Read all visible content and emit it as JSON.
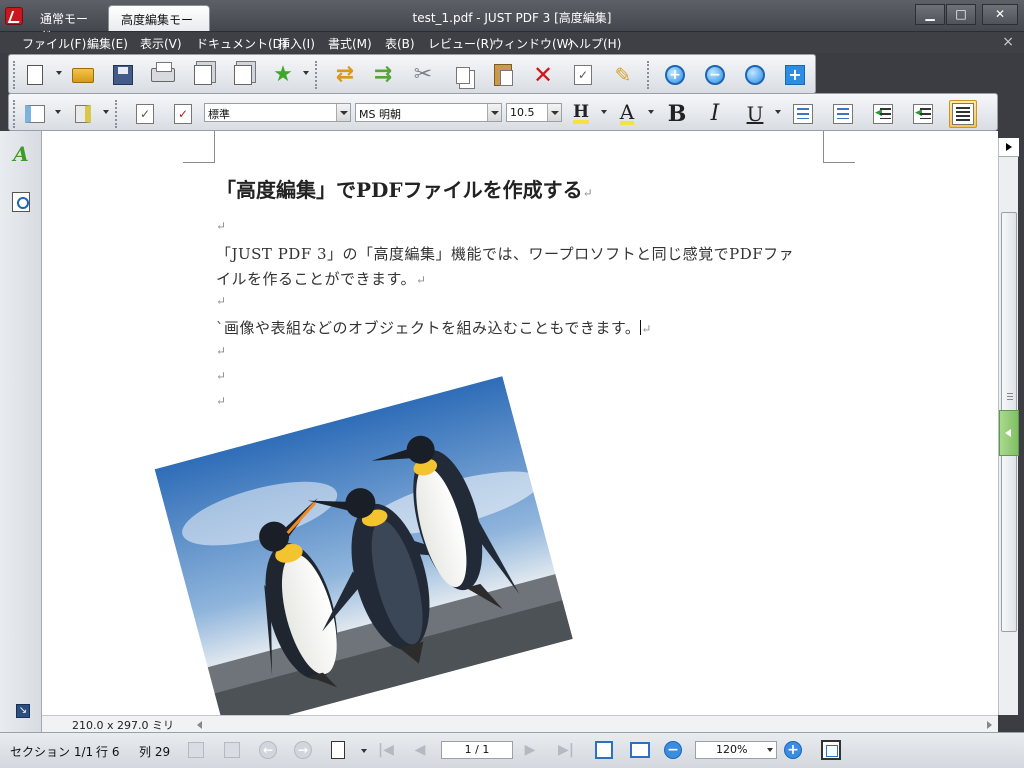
{
  "window": {
    "title": "test_1.pdf - JUST PDF 3 [高度編集]",
    "tabs": [
      {
        "label": "通常モード",
        "active": false
      },
      {
        "label": "高度編集モード",
        "active": true
      }
    ],
    "controls": {
      "minimize": "▁",
      "maximize": "□",
      "close": "✕"
    }
  },
  "menu": {
    "items": [
      "ファイル(F)",
      "編集(E)",
      "表示(V)",
      "ドキュメント(D)",
      "挿入(I)",
      "書式(M)",
      "表(B)",
      "レビュー(R)",
      "ウィンドウ(W)",
      "ヘルプ(H)"
    ],
    "close_label": "×"
  },
  "toolbar1": {
    "icons": [
      "new-document-icon",
      "open-folder-icon",
      "save-icon",
      "print-icon",
      "export-icon",
      "page-settings-icon",
      "favorite-star-icon",
      "undo-arrow-icon",
      "redo-arrow-icon",
      "cut-scissors-icon",
      "copy-icon",
      "paste-icon",
      "delete-x-icon",
      "text-select-icon",
      "format-brush-icon",
      "zoom-in-icon",
      "zoom-out-icon",
      "zoom-icon",
      "add-icon"
    ],
    "glyphs": {
      "star": "★",
      "arrow_left": "⇄",
      "arrow_right": "⇉",
      "scissors": "✂",
      "x": "✕",
      "brush": "✎",
      "zoom_in": "+",
      "zoom_out": "−",
      "zoom": "",
      "add": "+"
    }
  },
  "toolbar2": {
    "paragraph_style": "標準",
    "font_name": "MS 明朝",
    "font_size": "10.5",
    "glyphs": {
      "check": "✓",
      "highlight": "H",
      "font_color": "A",
      "bold": "B",
      "italic": "I",
      "underline": "U",
      "indent_arrow": "◀"
    }
  },
  "sidebar": {
    "pen_glyph": "A",
    "bottom_glyph": "↘"
  },
  "document": {
    "heading": "「高度編集」でPDFファイルを作成する",
    "paragraph_mark": "↵",
    "line1": "「JUST PDF 3」の「高度編集」機能では、ワープロソフトと同じ感覚でPDFファ",
    "line2": "イルを作ることができます。",
    "line3": "`画像や表組などのオブジェクトを組み込むこともできます。",
    "image_icon": "penguins-photo"
  },
  "info_strip": {
    "page_size": "210.0 x 297.0 ミリ"
  },
  "statusbar": {
    "section": "セクション 1/1",
    "row": "行 6",
    "column": "列 29",
    "page_indicator": "1 / 1",
    "zoom": "120%",
    "glyphs": {
      "back": "←",
      "forward": "→",
      "first": "|◀",
      "prev": "◀",
      "next": "▶",
      "last": "▶|",
      "zoom_out": "−",
      "zoom_in": "+"
    }
  },
  "colors": {
    "titlebar": "#44474d",
    "menubar": "#3e4046",
    "accent_blue": "#2d8de0",
    "delete_red": "#d0181e",
    "highlight_yellow": "#f3e33a"
  }
}
